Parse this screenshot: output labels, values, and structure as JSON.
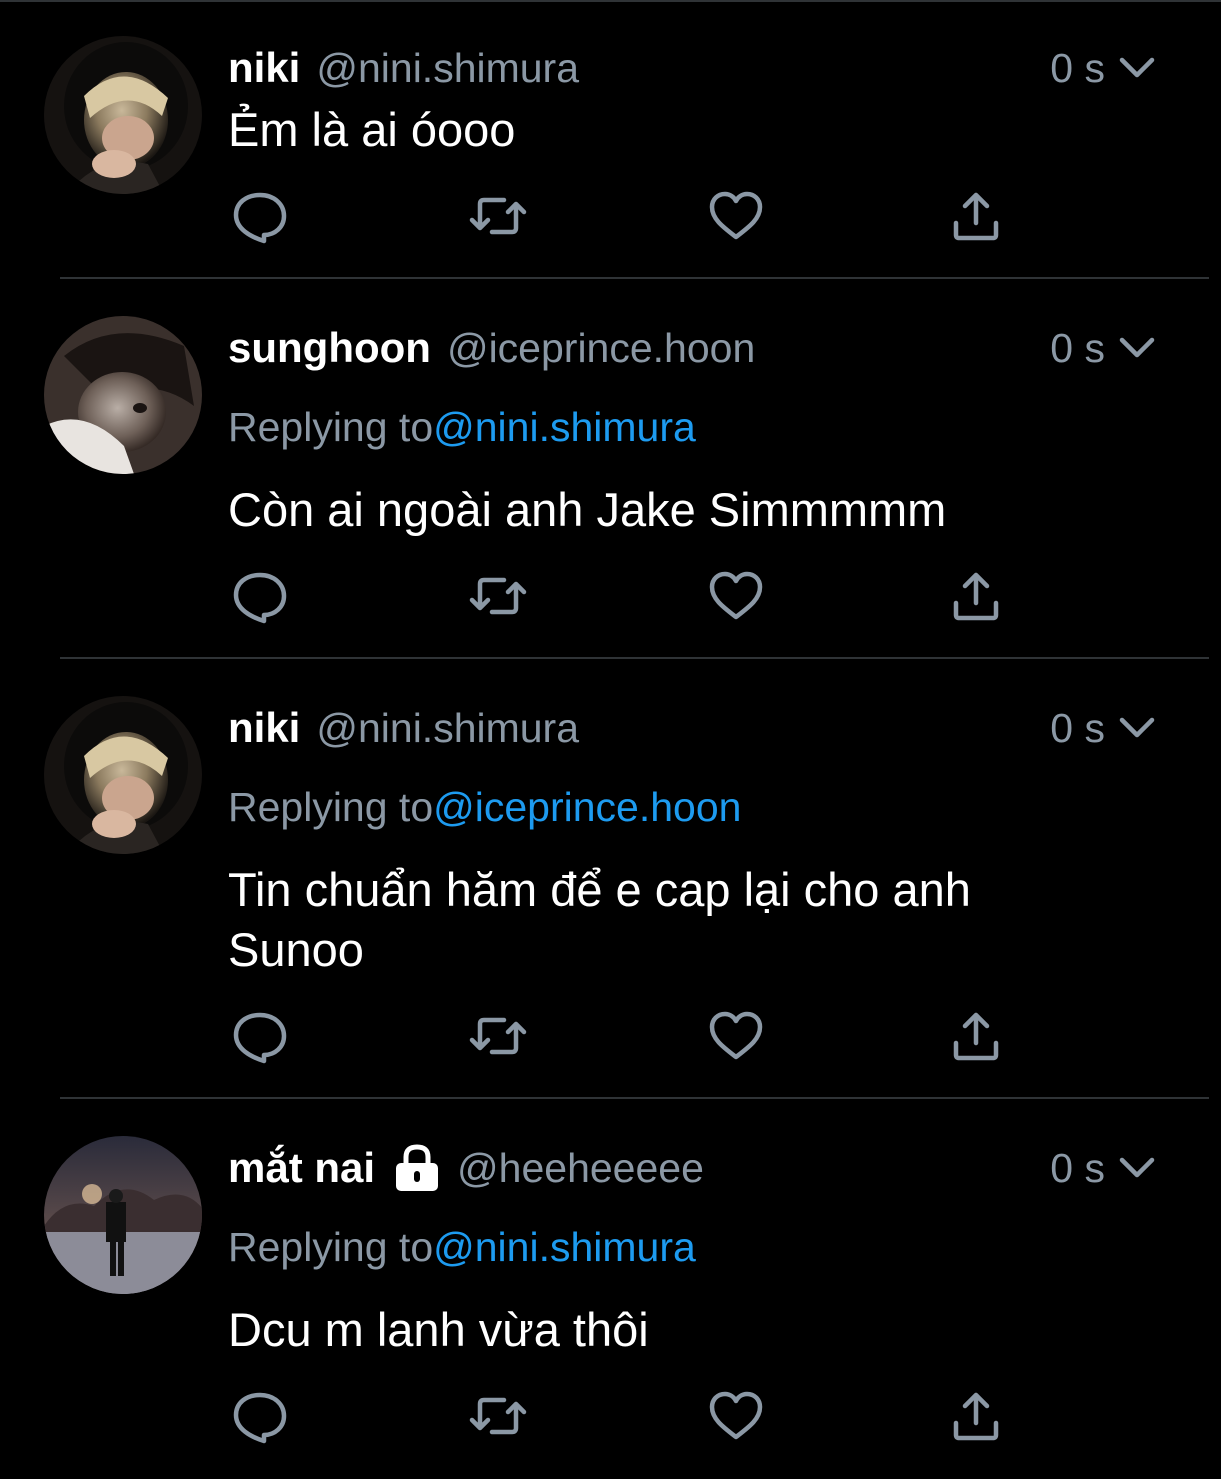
{
  "tweets": [
    {
      "name": "niki",
      "handle": "@nini.shimura",
      "locked": false,
      "time": "0 s",
      "replying_prefix": "",
      "replying_to": "",
      "text": "Ẻm là ai óooo",
      "avatar": "avatar-blond-hood"
    },
    {
      "name": "sunghoon",
      "handle": "@iceprince.hoon",
      "locked": false,
      "time": "0 s",
      "replying_prefix": "Replying to",
      "replying_to": "@nini.shimura",
      "text": "Còn ai ngoài anh Jake Simmmmm",
      "avatar": "avatar-dark-hair"
    },
    {
      "name": "niki",
      "handle": "@nini.shimura",
      "locked": false,
      "time": "0 s",
      "replying_prefix": "Replying to",
      "replying_to": "@iceprince.hoon",
      "text": "Tin chuẩn hăm để e cap lại cho anh Sunoo",
      "avatar": "avatar-blond-hood"
    },
    {
      "name": "mắt nai",
      "handle": "@heeheeeee",
      "locked": true,
      "time": "0 s",
      "replying_prefix": "Replying to",
      "replying_to": "@nini.shimura",
      "text": "Dcu m lanh vừa thôi",
      "avatar": "avatar-night-scene"
    }
  ],
  "icons": {
    "reply": "reply-icon",
    "retweet": "retweet-icon",
    "like": "heart-icon",
    "share": "share-icon",
    "more": "chevron-down-icon",
    "protected": "lock-icon"
  },
  "colors": {
    "background": "#000000",
    "primary_text": "#ffffff",
    "secondary_text": "#8b98a5",
    "link": "#1d9bf0",
    "divider": "#2f3336"
  }
}
